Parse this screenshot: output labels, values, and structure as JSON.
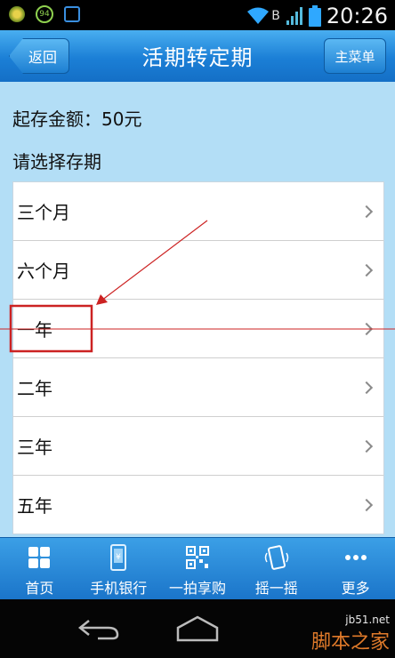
{
  "status_bar": {
    "badge_number": "94",
    "network": "B",
    "time": "20:26"
  },
  "header": {
    "title": "活期转定期",
    "back_label": "返回",
    "menu_label": "主菜单"
  },
  "content": {
    "min_amount": "起存金额：50元",
    "select_label": "请选择存期",
    "options": [
      {
        "label": "三个月"
      },
      {
        "label": "六个月"
      },
      {
        "label": "一年"
      },
      {
        "label": "二年"
      },
      {
        "label": "三年"
      },
      {
        "label": "五年"
      }
    ]
  },
  "tabbar": {
    "items": [
      {
        "label": "首页",
        "icon": "grid-icon"
      },
      {
        "label": "手机银行",
        "icon": "phone-yen-icon"
      },
      {
        "label": "一拍享购",
        "icon": "qr-code-icon"
      },
      {
        "label": "摇一摇",
        "icon": "shake-phone-icon"
      },
      {
        "label": "更多",
        "icon": "more-dots-icon"
      }
    ]
  },
  "watermark": {
    "domain": "jb51.net",
    "brand": "脚本之家"
  },
  "colors": {
    "header_blue": "#1b7fd6",
    "content_bg": "#b3def6",
    "annotation_red": "#cc2222"
  }
}
